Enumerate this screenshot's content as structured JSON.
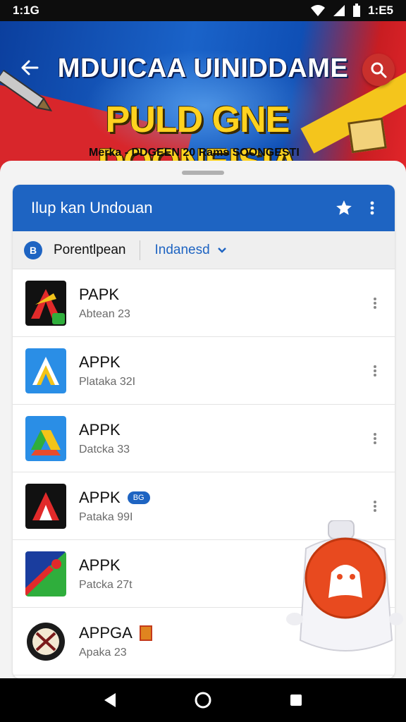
{
  "status_bar": {
    "time_left": "1:1G",
    "time_right": "1:E5"
  },
  "banner": {
    "title": "MDUICAA UINIDDAME",
    "headline": "PULD GNE DOONEISIA",
    "subtitle": "Merka - DDGEEN 20 Rams   SOONGESTI",
    "colors": {
      "blue": "#1a63c9",
      "red": "#d8262b",
      "yellow": "#ffd21f"
    }
  },
  "card": {
    "header_title": "Ilup kan Undouan",
    "filter": {
      "icon_letter": "B",
      "label": "Porentlpean",
      "selected": "Indanesd"
    }
  },
  "apps": [
    {
      "title": "PAPK",
      "subtitle": "Abtean 23",
      "icon": "red-a-icon"
    },
    {
      "title": "APPK",
      "subtitle": "Plataka 32I",
      "icon": "blue-a-icon"
    },
    {
      "title": "APPK",
      "subtitle": "Datcka 33",
      "icon": "drive-icon"
    },
    {
      "title": "APPK",
      "subtitle": "Pataka 99I",
      "badge": "BG",
      "icon": "black-a-icon"
    },
    {
      "title": "APPK",
      "subtitle": "Patcka 27t",
      "icon": "green-card-icon"
    },
    {
      "title": "APPGA",
      "subtitle": "Apaka 23",
      "icon": "emblem-icon"
    }
  ],
  "accent_color": "#1e64c2"
}
